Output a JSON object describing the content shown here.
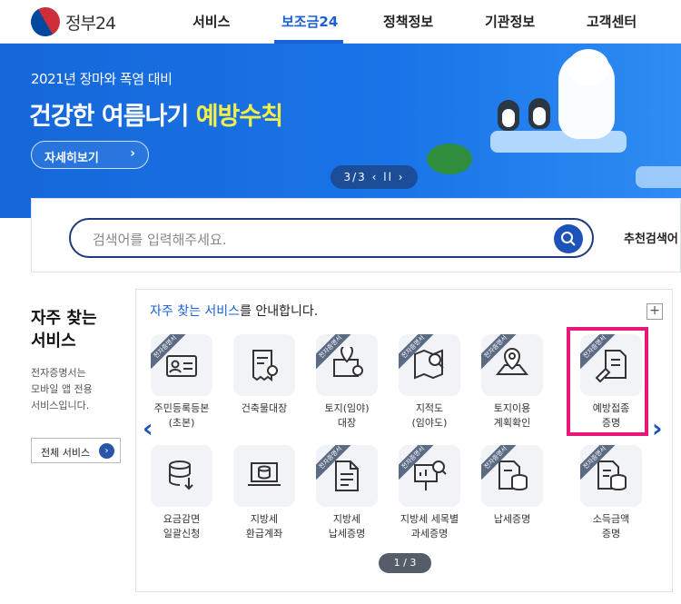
{
  "header": {
    "logo_text": "정부24",
    "nav": [
      "서비스",
      "보조금24",
      "정책정보",
      "기관정보",
      "고객센터"
    ],
    "active_nav": "보조금24"
  },
  "banner": {
    "subtitle": "2021년 장마와 폭염 대비",
    "title_plain": "건강한 여름나기 ",
    "title_highlight": "예방수칙",
    "button_label": "자세히보기",
    "pager": "3/3"
  },
  "search": {
    "placeholder": "검색어를 입력해주세요.",
    "recommend_label": "추천검색어"
  },
  "sidebar": {
    "title_line1": "자주 찾는",
    "title_line2": "서비스",
    "desc_line1": "전자증명서는",
    "desc_line2": "모바일 앱 전용",
    "desc_line3": "서비스입니다.",
    "all_services_label": "전체 서비스"
  },
  "panel": {
    "title_highlight": "자주 찾는 서비스",
    "title_rest": "를 안내합니다.",
    "pager": "1 / 3",
    "tag_text": "전자증명서",
    "services": [
      {
        "label": "주민등록등본\n(초본)",
        "icon": "id-card-icon",
        "tagged": true
      },
      {
        "label": "건축물대장",
        "icon": "receipt-search-icon",
        "tagged": false
      },
      {
        "label": "토지(임야)\n대장",
        "icon": "land-register-icon",
        "tagged": true
      },
      {
        "label": "지적도\n(임야도)",
        "icon": "map-search-icon",
        "tagged": true
      },
      {
        "label": "토지이용\n계획확인",
        "icon": "map-pin-icon",
        "tagged": true
      },
      {
        "label": "예방접종\n증명",
        "icon": "syringe-doc-icon",
        "tagged": true
      },
      {
        "label": "요금감면\n일괄신청",
        "icon": "database-down-icon",
        "tagged": false
      },
      {
        "label": "지방세\n환급계좌",
        "icon": "laptop-database-icon",
        "tagged": false
      },
      {
        "label": "지방세\n납세증명",
        "icon": "document-icon",
        "tagged": true
      },
      {
        "label": "지방세 세목별\n과세증명",
        "icon": "presentation-search-icon",
        "tagged": true
      },
      {
        "label": "납세증명",
        "icon": "doc-database-icon",
        "tagged": true
      },
      {
        "label": "소득금액\n증명",
        "icon": "doc-database-2-icon",
        "tagged": true
      }
    ]
  }
}
